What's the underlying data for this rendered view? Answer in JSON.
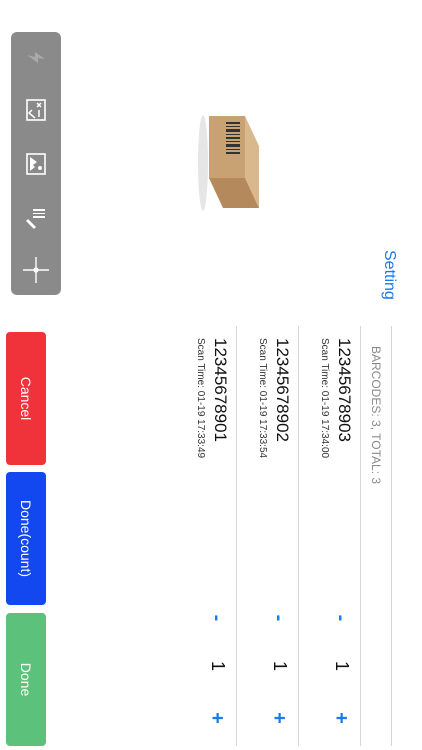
{
  "header": {
    "setting_label": "Setting"
  },
  "list": {
    "summary": "BARCODES: 3, TOTAL: 3",
    "items": [
      {
        "code": "12345678903",
        "time": "Scan Time: 01-19 17:34:00",
        "qty": "1"
      },
      {
        "code": "12345678902",
        "time": "Scan Time: 01-19 17:33:54",
        "qty": "1"
      },
      {
        "code": "12345678901",
        "time": "Scan Time: 01-19 17:33:49",
        "qty": "1"
      }
    ],
    "minus_label": "-",
    "plus_label": "+"
  },
  "actions": {
    "cancel": "Cancel",
    "done_count": "Done(count)",
    "done": "Done"
  },
  "tools": {
    "icons": [
      "flash-icon",
      "manual-entry-icon",
      "image-scan-icon",
      "barcode-edit-icon",
      "crosshair-icon"
    ]
  },
  "colors": {
    "accent": "#1a7ae8",
    "cancel": "#f0323a",
    "done_count": "#1347f0",
    "done": "#5cc17a",
    "panel": "#8a8a8a"
  }
}
